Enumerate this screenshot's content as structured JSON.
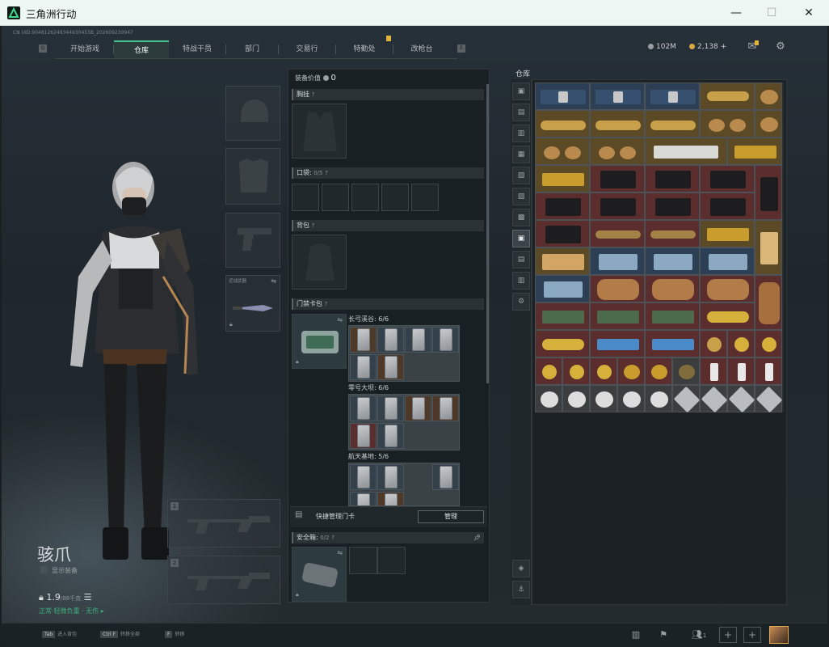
{
  "window": {
    "title": "三角洲行动",
    "minimize": "—",
    "maximize": "☐",
    "close": "✕"
  },
  "header": {
    "uid": "CN UID:9048126249344930455B_202609230947",
    "tabs": [
      {
        "label": "开始游戏"
      },
      {
        "label": "仓库",
        "active": true
      },
      {
        "label": "特战干员"
      },
      {
        "label": "部门"
      },
      {
        "label": "交易行"
      },
      {
        "label": "特勤处"
      },
      {
        "label": "改枪台"
      }
    ],
    "key_left": "Q",
    "key_right": "E",
    "currency_silver": "102M",
    "currency_gold": "2,138",
    "currency_plus": "+"
  },
  "character": {
    "name": "骇爪",
    "show_equipment_label": "显示装备",
    "weight": "1.9",
    "weight_max": "/88千克",
    "status": "正常·轻微负重 · 无伤 ▸"
  },
  "equip": {
    "secure_case_slot_label": "安全箱",
    "weapon_slot_1": "1",
    "weapon_slot_2": "2"
  },
  "mid": {
    "value_label": "装备价值",
    "value": "0",
    "chest_label": "胸挂",
    "chest_q": "?",
    "pockets_label": "口袋:",
    "pockets_value": "0/5",
    "backpack_label": "背包",
    "keycase_label": "门禁卡包",
    "key_sections": [
      {
        "label": "长弓溪谷: 6/6"
      },
      {
        "label": "零号大坝: 6/6"
      },
      {
        "label": "航天基地: 5/6"
      }
    ],
    "manage_label": "快捷管理门卡",
    "manage_button": "管理",
    "safebox_label": "安全箱:",
    "safebox_value": "0/2"
  },
  "repo": {
    "title": "仓库",
    "side_buttons": [
      "▣",
      "▤",
      "▥",
      "▦",
      "▧",
      "▨",
      "▩",
      "▣",
      "▤",
      "▥",
      "⚙"
    ]
  },
  "bottom": {
    "hints": [
      {
        "key": "Tab",
        "text": "进入背包"
      },
      {
        "key": "Ctrl F",
        "text": "转移全部"
      },
      {
        "key": "F",
        "text": "转移"
      }
    ],
    "squad_count": "1"
  },
  "colors": {
    "accent": "#46c08f",
    "gold": "#d7a942",
    "card_red": "#5b2d2d"
  }
}
